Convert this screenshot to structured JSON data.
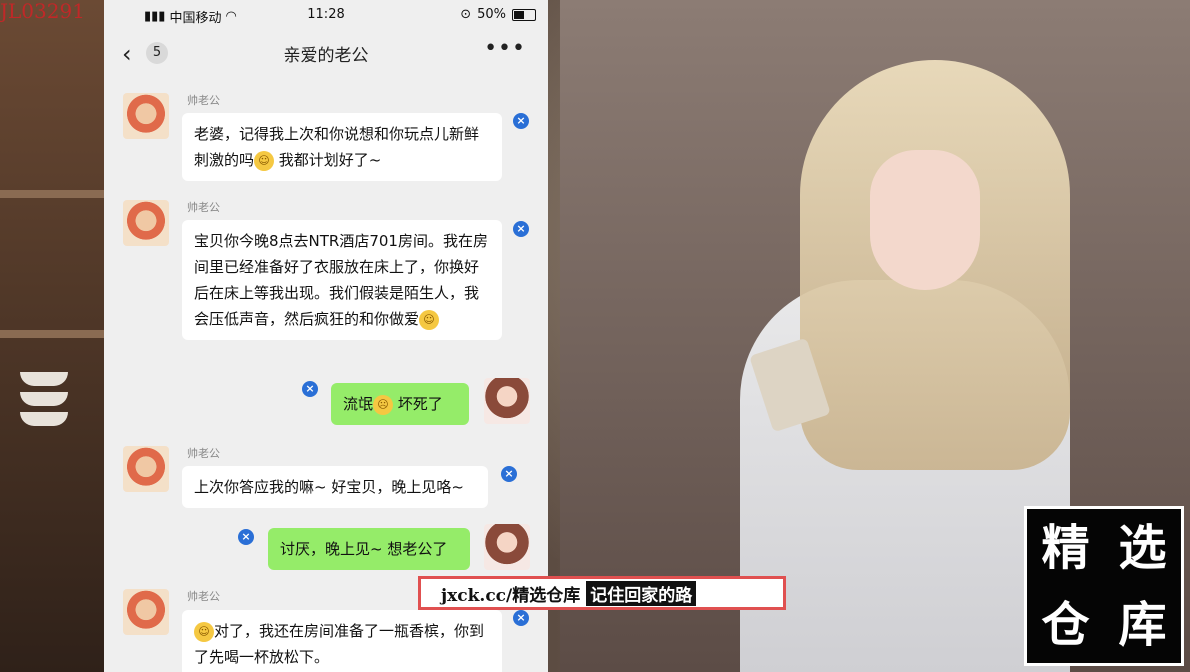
{
  "corner_code": "JL03291",
  "status_bar": {
    "carrier": "中国移动",
    "time": "11:28",
    "battery": "50%"
  },
  "nav": {
    "unread": "5",
    "title": "亲爱的老公"
  },
  "messages": [
    {
      "sender": "帅老公",
      "text": "老婆，记得我上次和你说想和你玩点儿新鲜刺激的吗",
      "after_emoji": "我都计划好了~"
    },
    {
      "sender": "帅老公",
      "text": "宝贝你今晚8点去NTR酒店701房间。我在房间里已经准备好了衣服放在床上了，你换好后在床上等我出现。我们假装是陌生人，我会压低声音，然后疯狂的和你做爱"
    },
    {
      "text": "流氓",
      "after_emoji": "坏死了"
    },
    {
      "sender": "帅老公",
      "text": "上次你答应我的嘛~ 好宝贝，晚上见咯~"
    },
    {
      "text": "讨厌，晚上见~ 想老公了"
    },
    {
      "sender": "帅老公",
      "text": "对了，我还在房间准备了一瓶香槟，你到了先喝一杯放松下。"
    }
  ],
  "watermark": {
    "url": "jxck.cc/精选仓库",
    "slogan": "记住回家的路"
  },
  "stamp": {
    "chars": [
      "精",
      "选",
      "仓",
      "库"
    ]
  },
  "colors": {
    "my_bubble": "#95ec69",
    "their_bubble": "#ffffff",
    "badge": "#2a6fd6",
    "watermark_border": "#e05050"
  }
}
